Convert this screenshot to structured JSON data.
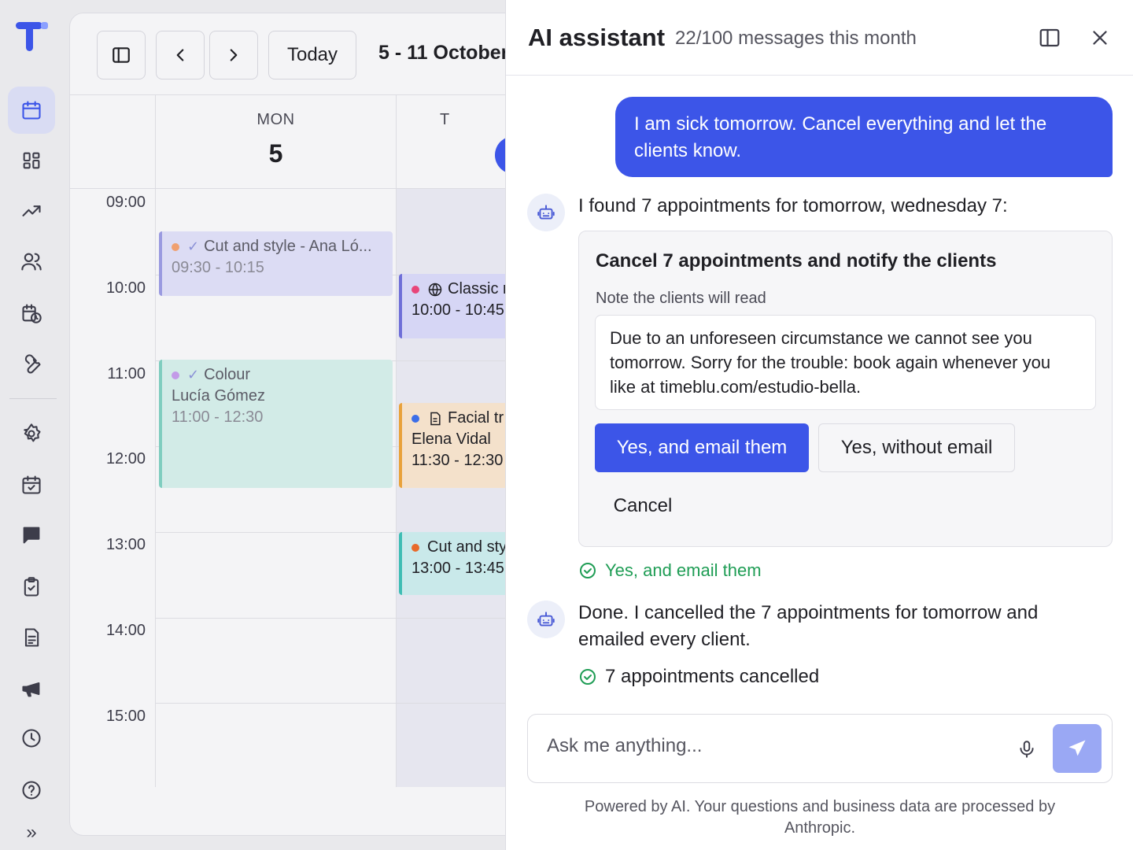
{
  "rail": {
    "items": [
      "calendar-icon",
      "dashboard-icon",
      "trending-icon",
      "users-icon",
      "schedule-icon",
      "wrench-icon",
      "gear-icon",
      "calendar-check-icon",
      "chat-icon",
      "clipboard-check-icon",
      "document-icon",
      "megaphone-icon",
      "clock-icon",
      "help-icon"
    ],
    "expand": "»"
  },
  "toolbar": {
    "today_label": "Today",
    "range": "5 - 11 October"
  },
  "days": [
    {
      "name": "MON",
      "num": "5"
    },
    {
      "name": "T",
      "num": ""
    }
  ],
  "hours": [
    "09:00",
    "10:00",
    "11:00",
    "12:00",
    "13:00",
    "14:00",
    "15:00"
  ],
  "events": {
    "mon_cut": {
      "title": "Cut and style - Ana Ló...",
      "time": "09:30 - 10:15",
      "dot": "#f0a070"
    },
    "mon_colour": {
      "title": "Colour",
      "client": "Lucía Gómez",
      "time": "11:00 - 12:30",
      "dot": "#c39be8"
    },
    "tue_classic": {
      "title": "Classic r",
      "time": "10:00 - 10:45",
      "dot": "#e8457a"
    },
    "tue_facial": {
      "title": "Facial tr",
      "client": "Elena Vidal",
      "time": "11:30 - 12:30",
      "dot": "#3c6ee8"
    },
    "tue_cut": {
      "title": "Cut and sty",
      "time": "13:00 - 13:45",
      "dot": "#e86a2a"
    }
  },
  "assistant": {
    "title": "AI assistant",
    "quota": "22/100 messages this month",
    "user_message": "I am sick tomorrow. Cancel everything and let the clients know.",
    "bot_message_1": "I found 7 appointments for tomorrow, wednesday 7:",
    "card": {
      "title": "Cancel 7 appointments and notify the clients",
      "note_label": "Note the clients will read",
      "note_text": "Due to an unforeseen circumstance we cannot see you tomorrow. Sorry for the trouble: book again whenever you like at timeblu.com/estudio-bella.",
      "primary_label": "Yes, and email them",
      "secondary_label": "Yes, without email",
      "cancel_label": "Cancel"
    },
    "choice_confirmation": "Yes, and email them",
    "bot_message_2": "Done. I cancelled the 7 appointments for tomorrow and emailed every client.",
    "result_status": "7 appointments cancelled",
    "composer_placeholder": "Ask me anything...",
    "footer_note": "Powered by AI. Your questions and business data are processed by Anthropic."
  },
  "colors": {
    "accent": "#3c55e8",
    "success": "#1f9d55"
  }
}
